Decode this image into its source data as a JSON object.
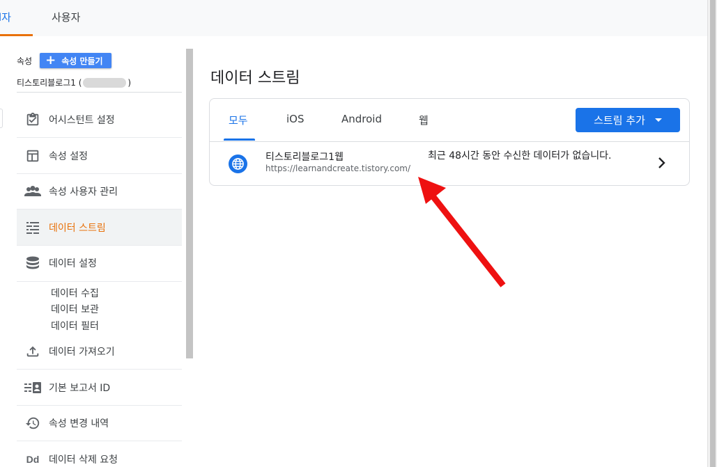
{
  "top_tabs": [
    {
      "label": "자",
      "prefix": "l",
      "active": true
    },
    {
      "label": "사용자",
      "active": false
    }
  ],
  "property": {
    "label": "속성",
    "create_button": "속성 만들기",
    "name_prefix": "티스토리블로그1 (",
    "name_suffix": ")"
  },
  "nav": [
    {
      "label": "어시스턴트 설정",
      "icon": "clipboard-check-icon"
    },
    {
      "label": "속성 설정",
      "icon": "layout-icon"
    },
    {
      "label": "속성 사용자 관리",
      "icon": "people-icon"
    },
    {
      "label": "데이터 스트림",
      "icon": "streams-icon",
      "active": true
    },
    {
      "label": "데이터 설정",
      "icon": "database-icon"
    },
    {
      "label": "데이터 가져오기",
      "icon": "upload-icon"
    },
    {
      "label": "기본 보고서 ID",
      "icon": "id-card-icon"
    },
    {
      "label": "속성 변경 내역",
      "icon": "history-icon"
    },
    {
      "label": "데이터 삭제 요청",
      "icon": "dd-icon",
      "icon_text": "Dd"
    }
  ],
  "nav_sub": [
    "데이터 수집",
    "데이터 보관",
    "데이터 필터"
  ],
  "main": {
    "title": "데이터 스트림",
    "tabs": [
      "모두",
      "iOS",
      "Android",
      "웹"
    ],
    "add_button": "스트림 추가",
    "stream": {
      "name": "티스토리블로그1웹",
      "url": "https://learnandcreate.tistory.com/",
      "status": "최근 48시간 동안 수신한 데이터가 없습니다."
    }
  },
  "colors": {
    "accent": "#1a73e8",
    "active_nav": "#e8710a",
    "arrow": "#ee1111"
  }
}
